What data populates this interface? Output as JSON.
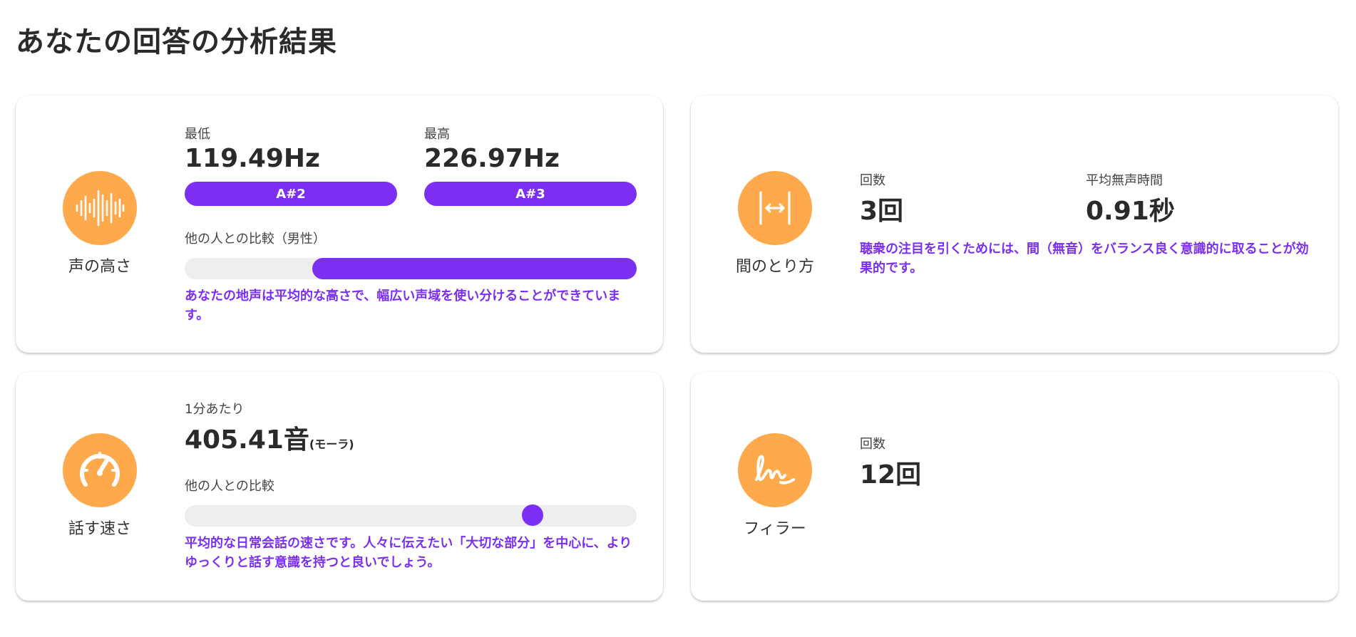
{
  "page": {
    "title": "あなたの回答の分析結果"
  },
  "pitch": {
    "label": "声の高さ",
    "icon": "sound-wave-icon",
    "min_label": "最低",
    "min_value": "119.49Hz",
    "min_note": "A#2",
    "max_label": "最高",
    "max_value": "226.97Hz",
    "max_note": "A#3",
    "comparison_label": "他の人との比較（男性）",
    "range_start_fraction": 0.283,
    "range_end_fraction": 1.0,
    "comment": "あなたの地声は平均的な高さで、幅広い声域を使い分けることができています。"
  },
  "pause": {
    "label": "間のとり方",
    "icon": "pause-width-icon",
    "count_label": "回数",
    "count_value": "3回",
    "avg_label": "平均無声時間",
    "avg_value": "0.91秒",
    "comment": "聴衆の注目を引くためには、間（無音）をバランス良く意識的に取ることが効果的です。"
  },
  "speed": {
    "label": "話す速さ",
    "icon": "speedometer-icon",
    "rate_label": "1分あたり",
    "rate_value": "405.41音",
    "rate_unit": "(モーラ)",
    "comparison_label": "他の人との比較",
    "position_fraction": 0.77,
    "comment": "平均的な日常会話の速さです。人々に伝えたい「大切な部分」を中心に、よりゆっくりと話す意識を持つと良いでしょう。"
  },
  "filler": {
    "label": "フィラー",
    "icon": "handwriting-icon",
    "count_label": "回数",
    "count_value": "12回"
  },
  "colors": {
    "accent": "#7b2ff2",
    "icon_bg": "#ffa94d",
    "track": "#eeeeee"
  }
}
